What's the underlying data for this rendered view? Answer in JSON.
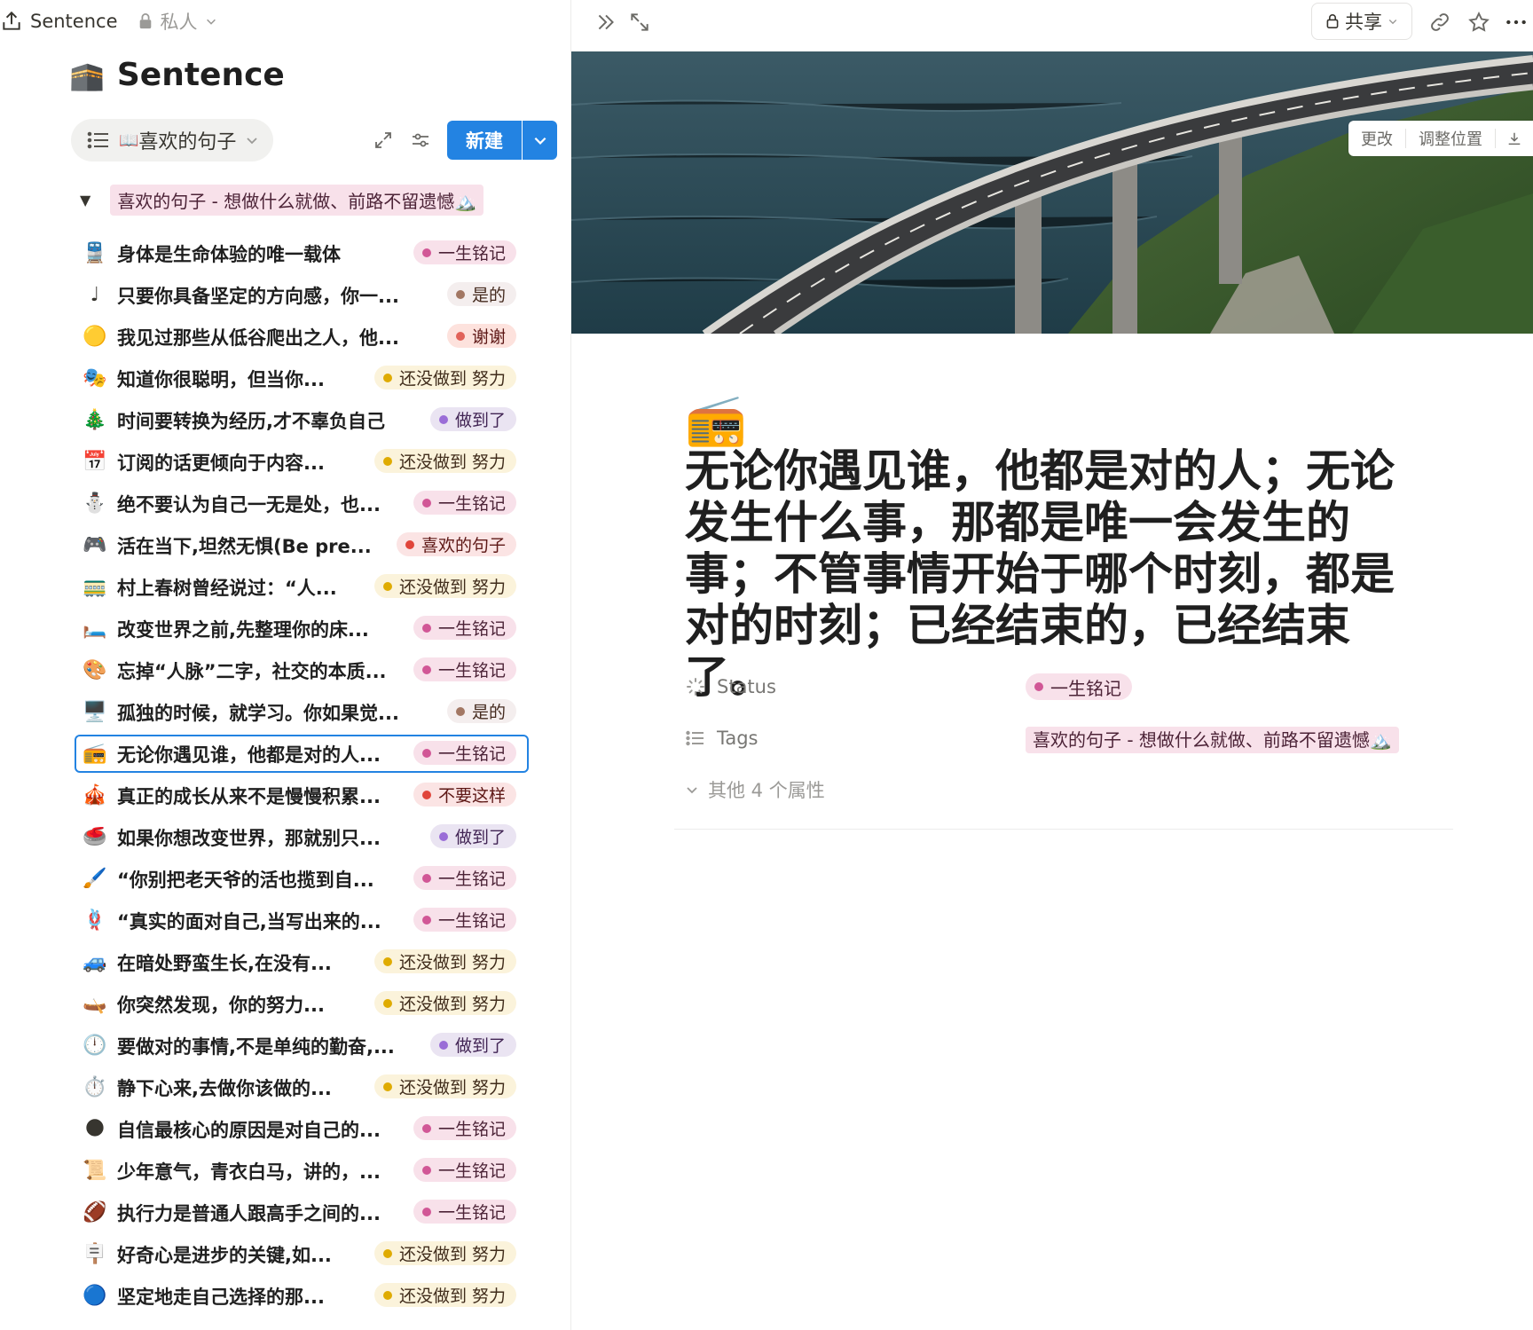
{
  "topbar": {
    "workspace": "Sentence",
    "privacy": "私人"
  },
  "database": {
    "emoji": "🕋",
    "title": "Sentence",
    "view_emoji": "📖",
    "view_name": "喜欢的句子",
    "new_button": "新建"
  },
  "group": {
    "label": "喜欢的句子 - 想做什么就做、前路不留遗憾🏔️"
  },
  "rows": [
    {
      "emoji": "🚆",
      "text": "身体是生命体验的唯一载体",
      "tag": "一生铭记",
      "color": "pink"
    },
    {
      "emoji": "♩",
      "text": "只要你具备坚定的方向感，你一...",
      "tag": "是的",
      "color": "brown"
    },
    {
      "emoji": "🟡",
      "text": "我见过那些从低谷爬出之人，他...",
      "tag": "谢谢",
      "color": "red"
    },
    {
      "emoji": "🎭",
      "text": "知道你很聪明，但当你...",
      "tag": "还没做到 努力",
      "color": "yellow"
    },
    {
      "emoji": "🎄",
      "text": "时间要转换为经历,才不辜负自己",
      "tag": "做到了",
      "color": "purple"
    },
    {
      "emoji": "📅",
      "text": "订阅的话更倾向于内容...",
      "tag": "还没做到 努力",
      "color": "yellow"
    },
    {
      "emoji": "⛄",
      "text": "绝不要认为自己一无是处，也...",
      "tag": "一生铭记",
      "color": "pink"
    },
    {
      "emoji": "🎮",
      "text": "活在当下,坦然无惧(Be pre...",
      "tag": "喜欢的句子",
      "color": "redpill"
    },
    {
      "emoji": "🚃",
      "text": "村上春树曾经说过：“人...",
      "tag": "还没做到 努力",
      "color": "yellow"
    },
    {
      "emoji": "🛏️",
      "text": "改变世界之前,先整理你的床...",
      "tag": "一生铭记",
      "color": "pink"
    },
    {
      "emoji": "🎨",
      "text": "忘掉“人脉”二字，社交的本质...",
      "tag": "一生铭记",
      "color": "pink"
    },
    {
      "emoji": "🖥️",
      "text": "孤独的时候，就学习。你如果觉...",
      "tag": "是的",
      "color": "brown"
    },
    {
      "emoji": "📻",
      "text": "无论你遇见谁，他都是对的人...",
      "tag": "一生铭记",
      "color": "pink",
      "selected": true
    },
    {
      "emoji": "🎪",
      "text": "真正的成长从来不是慢慢积累...",
      "tag": "不要这样",
      "color": "redpill"
    },
    {
      "emoji": "🥌",
      "text": "如果你想改变世界，那就别只...",
      "tag": "做到了",
      "color": "purple"
    },
    {
      "emoji": "🖌️",
      "text": "“你别把老天爷的活也揽到自...",
      "tag": "一生铭记",
      "color": "pink"
    },
    {
      "emoji": "🪢",
      "text": "“真实的面对自己,当写出来的...",
      "tag": "一生铭记",
      "color": "pink"
    },
    {
      "emoji": "🚙",
      "text": "在暗处野蛮生长,在没有...",
      "tag": "还没做到 努力",
      "color": "yellow"
    },
    {
      "emoji": "🛶",
      "text": "你突然发现，你的努力...",
      "tag": "还没做到 努力",
      "color": "yellow"
    },
    {
      "emoji": "🕛",
      "text": "要做对的事情,不是单纯的勤奋,...",
      "tag": "做到了",
      "color": "purple"
    },
    {
      "emoji": "⏱️",
      "text": "静下心来,去做你该做的...",
      "tag": "还没做到 努力",
      "color": "yellow"
    },
    {
      "emoji": "🌑",
      "text": "自信最核心的原因是对自己的...",
      "tag": "一生铭记",
      "color": "pink"
    },
    {
      "emoji": "📜",
      "text": "少年意气，青衣白马，讲的，...",
      "tag": "一生铭记",
      "color": "pink"
    },
    {
      "emoji": "🏈",
      "text": "执行力是普通人跟高手之间的...",
      "tag": "一生铭记",
      "color": "pink"
    },
    {
      "emoji": "🪧",
      "text": "好奇心是进步的关键,如...",
      "tag": "还没做到 努力",
      "color": "yellow"
    },
    {
      "emoji": "🔵",
      "text": "坚定地走自己选择的那...",
      "tag": "还没做到 努力",
      "color": "yellow"
    }
  ],
  "tag_colors": {
    "pink": {
      "bg": "#f8e1ea",
      "fg": "#4c2337",
      "dot": "#d15796"
    },
    "brown": {
      "bg": "#f4eeee",
      "fg": "#442a1e",
      "dot": "#a27763"
    },
    "red": {
      "bg": "#fde2dd",
      "fg": "#5d1715",
      "dot": "#e16259"
    },
    "redpill": {
      "bg": "#fbe4e4",
      "fg": "#5d1715",
      "dot": "#e0453a"
    },
    "yellow": {
      "bg": "#fbf3db",
      "fg": "#402c1b",
      "dot": "#dfab01"
    },
    "purple": {
      "bg": "#eae4f2",
      "fg": "#412454",
      "dot": "#9a6dd7"
    }
  },
  "page": {
    "share_label": "共享",
    "cover_change": "更改",
    "cover_reposition": "调整位置",
    "icon_emoji": "📻",
    "title": "无论你遇见谁，他都是对的人；无论发生什么事，那都是唯一会发生的事；不管事情开始于哪个时刻，都是对的时刻；已经结束的，已经结束了。",
    "props": {
      "status_label": "Status",
      "status_value": "一生铭记",
      "tags_label": "Tags",
      "tags_value": "喜欢的句子 - 想做什么就做、前路不留遗憾🏔️",
      "more": "其他 4 个属性"
    }
  }
}
